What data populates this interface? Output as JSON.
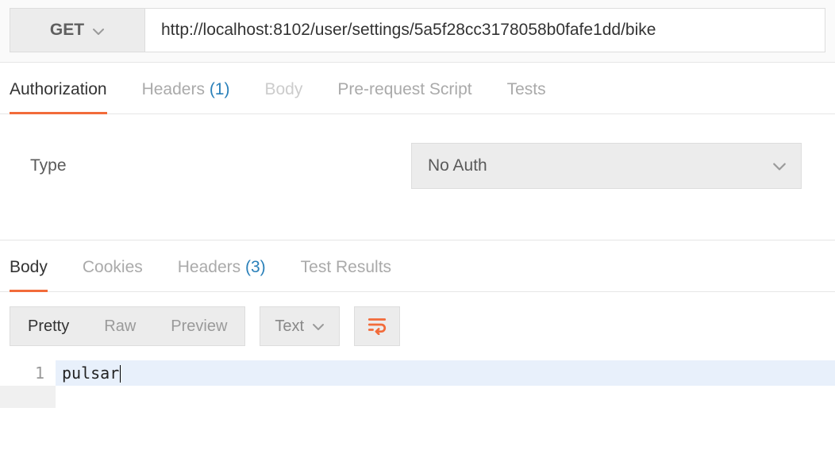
{
  "request": {
    "method": "GET",
    "url": "http://localhost:8102/user/settings/5a5f28cc3178058b0fafe1dd/bike"
  },
  "request_tabs": {
    "authorization": "Authorization",
    "headers_label": "Headers",
    "headers_count": "(1)",
    "body": "Body",
    "prerequest": "Pre-request Script",
    "tests": "Tests"
  },
  "auth": {
    "type_label": "Type",
    "selected": "No Auth"
  },
  "response_tabs": {
    "body": "Body",
    "cookies": "Cookies",
    "headers_label": "Headers",
    "headers_count": "(3)",
    "test_results": "Test Results"
  },
  "body_toolbar": {
    "pretty": "Pretty",
    "raw": "Raw",
    "preview": "Preview",
    "format": "Text"
  },
  "response_body": {
    "line_number": "1",
    "content": "pulsar"
  }
}
